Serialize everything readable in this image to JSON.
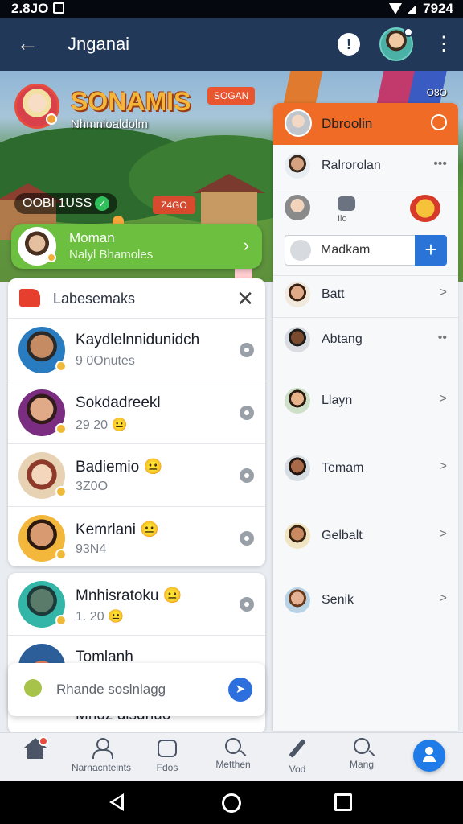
{
  "status_bar": {
    "time": "2.8JO",
    "right_text": "7924"
  },
  "app_bar": {
    "title": "Jnganai",
    "alert_label": "!"
  },
  "hero": {
    "brand": "SONAMIS",
    "brand_tag": "SOGAN",
    "brand_sub": "Nhmnioaldolm",
    "count_label": "OOBI 1USS",
    "live_tag": "Z4GO",
    "corner_text": "O8O",
    "pill": {
      "title": "Moman",
      "subtitle": "Nalyl Bhamoles"
    }
  },
  "list": {
    "title": "Labesemaks",
    "rows": [
      {
        "name": "Kaydlelnnidunidch",
        "sub": "9 0Onutes",
        "avatar_color": "#2a7cc0"
      },
      {
        "name": "Sokdadreekl",
        "sub": "29 20  😐",
        "avatar_color": "#7b2d82"
      },
      {
        "name": "Badiemio 😐",
        "sub": "3Z0O",
        "avatar_color": "#e7d2b4"
      },
      {
        "name": "Kemrlani 😐",
        "sub": "93N4",
        "avatar_color": "#f3b73b"
      }
    ],
    "rows2": [
      {
        "name": "Mnhisratoku 😐",
        "sub": "1. 20  😐",
        "avatar_color": "#33b5a8"
      },
      {
        "name": "Tomlanh",
        "sub": "",
        "avatar_color": "#2c5f9a"
      }
    ],
    "peek_name": "Mndz dlsdhuo"
  },
  "input": {
    "placeholder": "Rhande soslnlagg"
  },
  "right_panel": {
    "title": "Dbroolin",
    "rows": [
      {
        "name": "Ralrorolan",
        "control": "•••"
      },
      {
        "name": "",
        "sub": "Ilo",
        "control": ""
      },
      {
        "name": "Batt",
        "control": ">"
      },
      {
        "name": "Abtang",
        "control": "••"
      },
      {
        "name": "Llayn",
        "control": ">"
      },
      {
        "name": "Temam",
        "control": ">"
      },
      {
        "name": "Gelbalt",
        "control": ">"
      },
      {
        "name": "Senik",
        "control": ">"
      }
    ],
    "search_value": "Madkam"
  },
  "bottom_nav": [
    {
      "label": ""
    },
    {
      "label": "Narnacnteints"
    },
    {
      "label": "Fdos"
    },
    {
      "label": "Metthen"
    },
    {
      "label": "Vod"
    },
    {
      "label": "Mang"
    }
  ]
}
